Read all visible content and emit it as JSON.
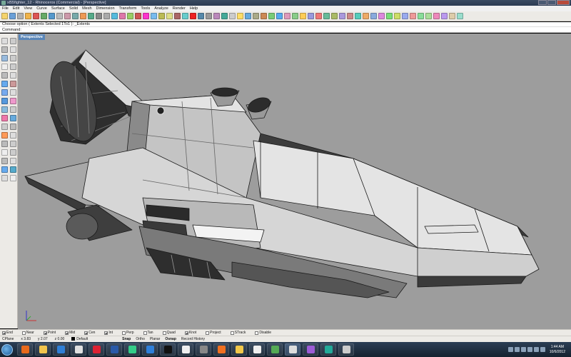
{
  "window": {
    "title": "xl55fighter_12 - Rhinoceros (Commercial) - [Perspective]"
  },
  "menu": [
    "File",
    "Edit",
    "View",
    "Curve",
    "Surface",
    "Solid",
    "Mesh",
    "Dimension",
    "Transform",
    "Tools",
    "Analyze",
    "Render",
    "Help"
  ],
  "command": {
    "history": "Choose option ( Extents  Selected  1To1 ): _Extents",
    "prompt": "Command:"
  },
  "viewport": {
    "tab_label": "Perspective",
    "background": "#9d9d9d",
    "active_tab_color": "#5a86b8"
  },
  "osnaps": [
    {
      "label": "End",
      "checked": true
    },
    {
      "label": "Near",
      "checked": false
    },
    {
      "label": "Point",
      "checked": true
    },
    {
      "label": "Mid",
      "checked": true
    },
    {
      "label": "Cen",
      "checked": true
    },
    {
      "label": "Int",
      "checked": true
    },
    {
      "label": "Perp",
      "checked": false
    },
    {
      "label": "Tan",
      "checked": false
    },
    {
      "label": "Quad",
      "checked": false
    },
    {
      "label": "Knot",
      "checked": true
    },
    {
      "label": "Project",
      "checked": false
    },
    {
      "label": "STrack",
      "checked": false
    },
    {
      "label": "Disable",
      "checked": false
    }
  ],
  "status": {
    "cplane": "CPlane",
    "x": "x 3.83",
    "y": "y 2.07",
    "z": "z 0.00",
    "layer": "Default",
    "panes": [
      "Snap",
      "Ortho",
      "Planar",
      "Osnap",
      "Record History"
    ]
  },
  "taskbar": {
    "apps": [
      "firefox",
      "explorer",
      "internet-explorer",
      "media-player",
      "app-red",
      "photoshop",
      "chrome",
      "app-blue",
      "app-dark",
      "app-white",
      "app-gear",
      "app-firefox-2",
      "app-explorer-2",
      "app-doc",
      "app-green",
      "app-rhino",
      "app-eye",
      "app-n",
      "app-sketch"
    ],
    "clock_time": "1:44 AM",
    "clock_date": "10/6/2012"
  }
}
